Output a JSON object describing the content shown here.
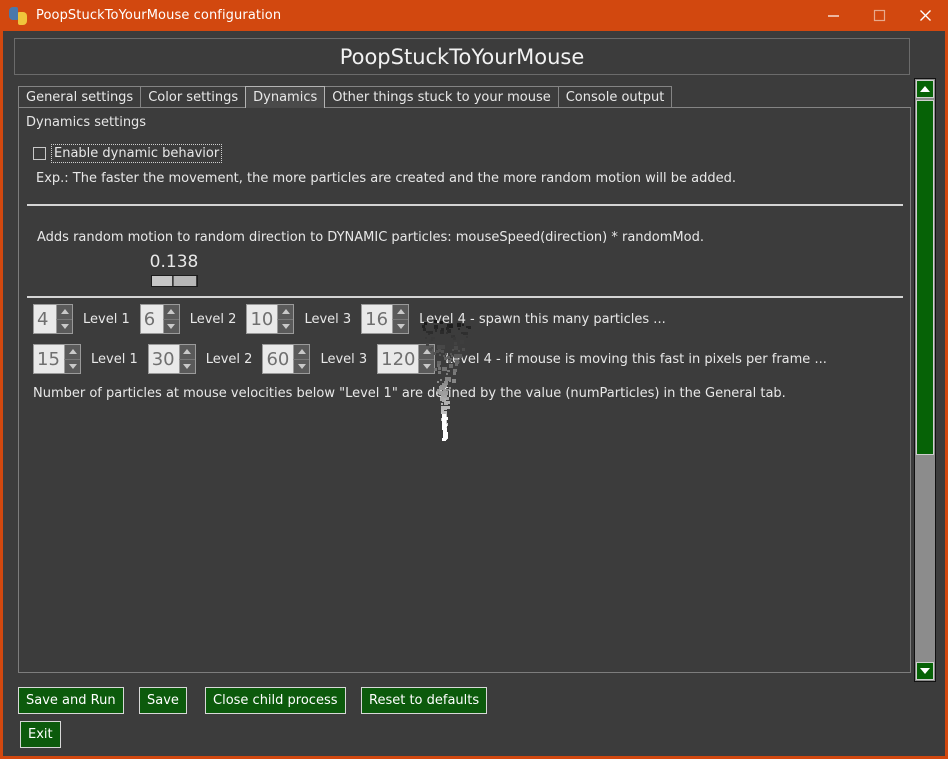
{
  "window": {
    "title": "PoopStuckToYourMouse configuration",
    "icon": "python-logo-icon",
    "titlebar_color": "#d2480f",
    "controls": {
      "minimize": "minimize-icon",
      "maximize": "maximize-icon",
      "close": "close-icon"
    }
  },
  "header": {
    "title": "PoopStuckToYourMouse"
  },
  "tabs": [
    {
      "label": "General settings",
      "active": false
    },
    {
      "label": "Color settings",
      "active": false
    },
    {
      "label": "Dynamics",
      "active": true
    },
    {
      "label": "Other things stuck to your mouse",
      "active": false
    },
    {
      "label": "Console output",
      "active": false
    }
  ],
  "panel": {
    "section_label": "Dynamics settings",
    "checkbox": {
      "label": "Enable dynamic behavior",
      "checked": false
    },
    "explain_text": "Exp.: The faster the movement, the more particles are created and the more random motion will be added.",
    "random_motion_text": "Adds random motion to random direction to DYNAMIC particles: mouseSpeed(direction) * randomMod.",
    "slider": {
      "value": "0.138",
      "fill_percent": 45
    },
    "particles_row": {
      "spins": [
        {
          "value": "4",
          "label": "Level 1"
        },
        {
          "value": "6",
          "label": "Level 2"
        },
        {
          "value": "10",
          "label": "Level 3"
        },
        {
          "value": "16",
          "label": "Level 4 - spawn this many particles ..."
        }
      ]
    },
    "speed_row": {
      "spins": [
        {
          "value": "15",
          "label": "Level 1"
        },
        {
          "value": "30",
          "label": "Level 2"
        },
        {
          "value": "60",
          "label": "Level 3"
        },
        {
          "value": "120",
          "label": "Level 4 - if mouse is moving this fast in pixels per frame ..."
        }
      ]
    },
    "footnote": "Number of particles at mouse velocities below \"Level 1\" are defined by the value (numParticles) in the General tab."
  },
  "scrollbar": {
    "up_arrow": "scroll-up-icon",
    "down_arrow": "scroll-down-icon",
    "thumb_color": "#066206"
  },
  "buttons": {
    "save_and_run": "Save and Run",
    "save": "Save",
    "close_child": "Close child process",
    "reset": "Reset to defaults",
    "exit": "Exit",
    "color": "#0c5a0c"
  }
}
